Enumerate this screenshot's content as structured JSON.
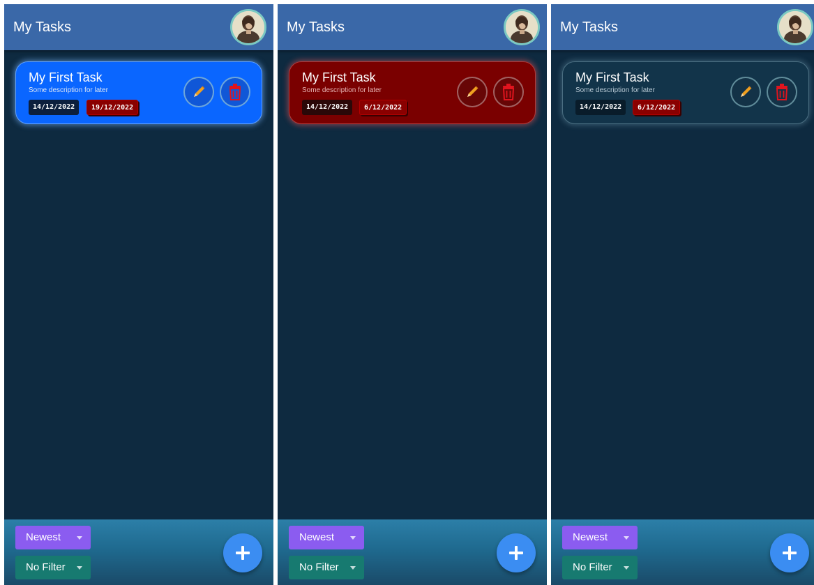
{
  "screens": [
    {
      "theme": "blue",
      "app_title": "My Tasks",
      "task": {
        "title": "My First Task",
        "description": "Some description for later",
        "start_date": "14/12/2022",
        "due_date": "19/12/2022"
      },
      "sort_label": "Newest",
      "filter_label": "No Filter"
    },
    {
      "theme": "red",
      "app_title": "My Tasks",
      "task": {
        "title": "My First Task",
        "description": "Some description for later",
        "start_date": "14/12/2022",
        "due_date": "6/12/2022"
      },
      "sort_label": "Newest",
      "filter_label": "No Filter"
    },
    {
      "theme": "dark",
      "app_title": "My Tasks",
      "task": {
        "title": "My First Task",
        "description": "Some description for later",
        "start_date": "14/12/2022",
        "due_date": "6/12/2022"
      },
      "sort_label": "Newest",
      "filter_label": "No Filter"
    }
  ],
  "icons": {
    "edit": "pencil-icon",
    "delete": "trash-icon",
    "add": "plus-icon",
    "dropdown": "caret-down-icon"
  },
  "colors": {
    "appbar": "#3a68a8",
    "background": "#0e2a40",
    "card_blue": "#0a66ff",
    "card_red": "#7a0000",
    "card_dark": "#12344a",
    "due_date": "#8a0000",
    "sort_dropdown": "#8b5cf0",
    "filter_dropdown": "#177a70",
    "fab": "#3b8df2",
    "pencil": "#f0a020",
    "trash": "#e0141e"
  }
}
